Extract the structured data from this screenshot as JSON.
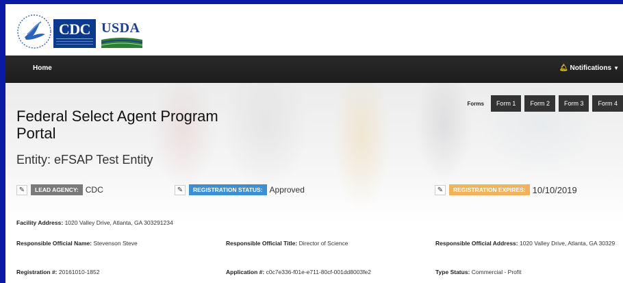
{
  "logos": {
    "cdc": "CDC",
    "usda": "USDA",
    "hhs_icon": "hhs-eagle-seal-icon"
  },
  "nav": {
    "home": "Home",
    "notifications": "Notifications",
    "notif_icon": "bell-icon"
  },
  "forms": {
    "label": "Forms",
    "buttons": [
      "Form 1",
      "Form 2",
      "Form 3",
      "Form 4"
    ]
  },
  "page": {
    "title": "Federal Select Agent Program Portal",
    "entity": "Entity: eFSAP Test Entity"
  },
  "status": {
    "lead_agency_label": "LEAD AGENCY:",
    "lead_agency_value": "CDC",
    "registration_status_label": "REGISTRATION STATUS:",
    "registration_status_value": "Approved",
    "registration_expires_label": "REGISTRATION EXPIRES:",
    "registration_expires_value": "10/10/2019"
  },
  "details": {
    "facility_address_label": "Facility Address:",
    "facility_address_value": "1020 Valley Drive, Atlanta, GA 303291234",
    "ro_name_label": "Responsible Official Name:",
    "ro_name_value": "Stevenson Steve",
    "ro_title_label": "Responsible Official Title:",
    "ro_title_value": "Director of Science",
    "ro_address_label": "Responsible Official Address:",
    "ro_address_value": "1020 Valley Drive, Atlanta, GA 30329",
    "registration_num_label": "Registration #:",
    "registration_num_value": "20161010-1852",
    "application_num_label": "Application #:",
    "application_num_value": "c0c7e336-f01e-e711-80cf-001dd8003fe2",
    "type_status_label": "Type Status:",
    "type_status_value": "Commercial - Profit"
  },
  "colors": {
    "outer_border": "#0a1aa6",
    "navbar": "#222222",
    "badge_gray": "#7a7a7a",
    "badge_blue": "#3c8fd0",
    "badge_orange": "#f0b35a"
  }
}
